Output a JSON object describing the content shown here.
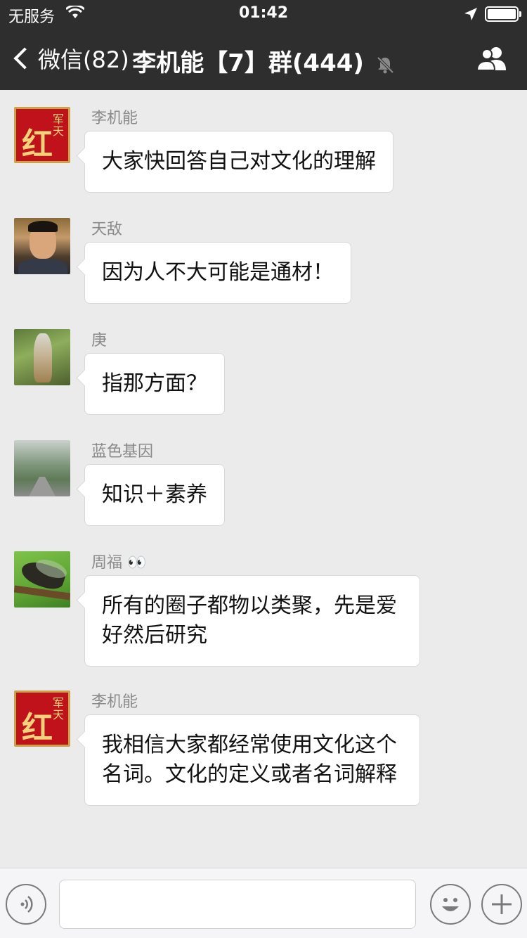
{
  "status_bar": {
    "carrier": "无服务",
    "time": "01:42"
  },
  "nav": {
    "back_label": "微信(82)",
    "title": "李机能【7】群(444)"
  },
  "messages": [
    {
      "sender": "李机能",
      "text": "大家快回答自己对文化的理解"
    },
    {
      "sender": "天敌",
      "text": "因为人不大可能是通材！"
    },
    {
      "sender": "庚",
      "text": "指那方面？"
    },
    {
      "sender": "蓝色基因",
      "text": "知识＋素养"
    },
    {
      "sender": "周福 👀",
      "text": "所有的圈子都物以类聚，先是爱好然后研究"
    },
    {
      "sender": "李机能",
      "text": "我相信大家都经常使用文化这个名词。文化的定义或者名词解释"
    }
  ],
  "avatar_labels": {
    "hong_mark": "红",
    "hong_sub": "军天"
  },
  "input_bar": {
    "placeholder": ""
  },
  "icons": {
    "wifi": "wifi-icon",
    "location": "location-arrow-icon",
    "battery": "battery-icon",
    "back": "chevron-left-icon",
    "mute": "bell-slash-icon",
    "group": "group-members-icon",
    "voice": "voice-icon",
    "emoji": "emoji-icon",
    "plus": "plus-icon"
  },
  "colors": {
    "header_bg": "#2e2e2e",
    "chat_bg": "#ebebeb",
    "bubble_bg": "#ffffff"
  }
}
